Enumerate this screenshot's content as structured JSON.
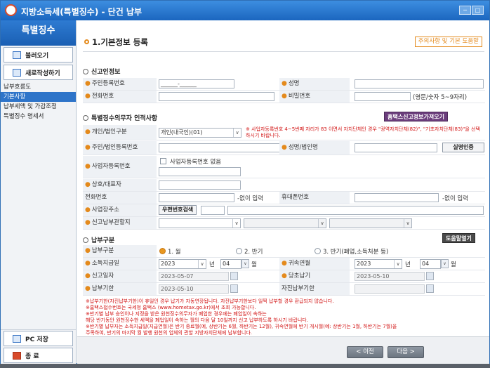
{
  "window": {
    "title": "지방소득세(특별징수) - 단건 납부",
    "min_label": "─",
    "max_label": "□"
  },
  "sidebar": {
    "header": "특별징수",
    "load_button": "불러오기",
    "new_button": "새로작성하기",
    "nav": [
      "납부흐름도",
      "기본사항",
      "납부세액 및 가감조정",
      "특별징수 명세서"
    ],
    "save_button": "PC 저장",
    "exit_button": "종 료"
  },
  "section": {
    "title": "1.기본정보 등록",
    "help_link": "주의사항 및 기본 도움말"
  },
  "reporter": {
    "title": "신고인정보",
    "resident_no_label": "주민등록번호",
    "resident_no_value": "______-______",
    "name_label": "성명",
    "phone_label": "전화번호",
    "password_label": "비밀번호",
    "password_hint": "(영문/숫자 5~9자리)"
  },
  "obligor": {
    "title": "특별징수의무자 인적사항",
    "fetch_button": "홈택스신고정보가져오기",
    "type_label": "개인/법인구분",
    "type_value": "개인(내국인)(01)",
    "type_warning": "※ 사업자등록번호 4~5번째 자리가 83 이면서 자치단체인 경우 \"광역자치단체(82)\", \"기초자치단체(83)\"을 선택하시기 바랍니다.",
    "id_label": "주민/법인등록번호",
    "name_label": "성명/법인명",
    "verify_button": "실명인증",
    "bizno_label": "사업자등록번호",
    "no_bizno_label": "사업자등록번호 없음",
    "trade_label": "상호/대표자",
    "tel_label": "전화번호",
    "tel_suffix": "-없이 입력",
    "mobile_label": "휴대폰번호",
    "mobile_suffix": "-없이 입력",
    "address_label": "사업장주소",
    "zip_button": "우편번호검색",
    "office_label": "신고납부관할지"
  },
  "payment": {
    "title": "납부구분",
    "help_button": "도움말열기",
    "type_label": "납부구분",
    "options": [
      "1. 월",
      "2. 반기",
      "3. 반기(폐업,소득처분 등)"
    ],
    "selected": "1. 월",
    "belong_label": "소득지급일",
    "belong_year": "2023",
    "belong_year_unit": "년",
    "belong_month": "04",
    "belong_month_unit": "월",
    "attr_label": "귀속연월",
    "attr_year": "2023",
    "attr_year_unit": "년",
    "attr_month": "04",
    "attr_month_unit": "월",
    "report_date_label": "신고일자",
    "report_date": "2023-05-07",
    "due_label": "당초납기",
    "due_date": "2023-05-10",
    "deadline_label": "납부기한",
    "deadline_date": "2023-05-10",
    "selfpay_label": "자진납부기한"
  },
  "notes": [
    "※납부기한(자진납부기한)이 휴일인 경우 납기가 자동연장됩니다. 자진납부기한보다 일찍 납부할 경우 환급되지 않습니다.",
    "※홈택스접수번호는 국세청 홈택스 (www.hometax.go.kr)에서 조회 가능합니다.",
    "※반기별 납부 승인이나 지정을 받은 원천징수의무자가 폐업한 경우에는 폐업일이 속하는",
    "   해당 반기동안 원천징수한 세액을 폐업일이 속하는 월의 다음 달 10일까지 신고 납부하도록 하시기 바랍니다.",
    "※반기별 납부자는 소득지급일(지급연월)은 반기 종료월(예, 상반기는 6월, 하반기는 12월), 귀속연월에 반기 개시월(예: 상반기는 1월, 하반기는 7월)을",
    "   주목하여, 반기의 마지막 월 발행 원천의 업체의 관할 지방자치단체에 납부합니다."
  ],
  "footer": {
    "prev_button": "< 이전",
    "next_button": "다음 >"
  },
  "colors": {
    "brand_blue": "#1b66bf",
    "accent_orange": "#e48a1c",
    "warning_red": "#d21414"
  },
  "icons": [
    "folder-icon",
    "document-icon",
    "floppy-icon",
    "exit-icon",
    "calendar-icon",
    "chevron-down-icon"
  ]
}
